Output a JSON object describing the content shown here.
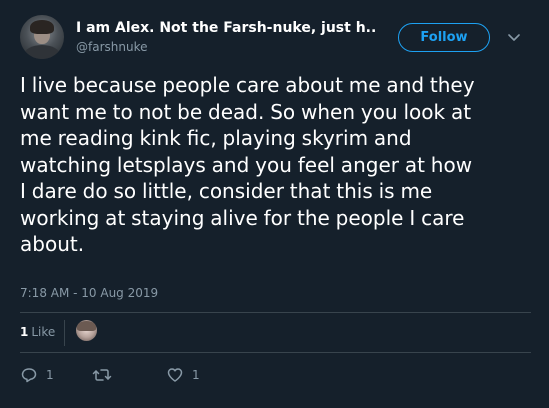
{
  "author": {
    "display_name": "I am Alex. Not the Farsh-nuke, just h...",
    "handle": "@farshnuke"
  },
  "header": {
    "follow_label": "Follow"
  },
  "tweet": {
    "text_lines": [
      "I live because people care about me and they",
      "want me to not be dead. So when you look at",
      "me reading kink fic, playing skyrim and",
      "watching letsplays and you feel anger at how",
      "I dare do so little, consider that this is me",
      "working at staying alive for the people I care",
      "about."
    ],
    "timestamp": "7:18 AM - 10 Aug 2019"
  },
  "stats": {
    "likes_count": "1",
    "likes_label": "Like"
  },
  "actions": {
    "reply_count": "1",
    "retweet_count": "",
    "like_count": "1"
  },
  "colors": {
    "background": "#15202b",
    "accent": "#1da1f2",
    "muted_text": "#8899a6",
    "divider": "#38444d"
  },
  "icons": {
    "menu": "chevron-down-icon",
    "reply": "reply-icon",
    "retweet": "retweet-icon",
    "like": "heart-icon"
  }
}
